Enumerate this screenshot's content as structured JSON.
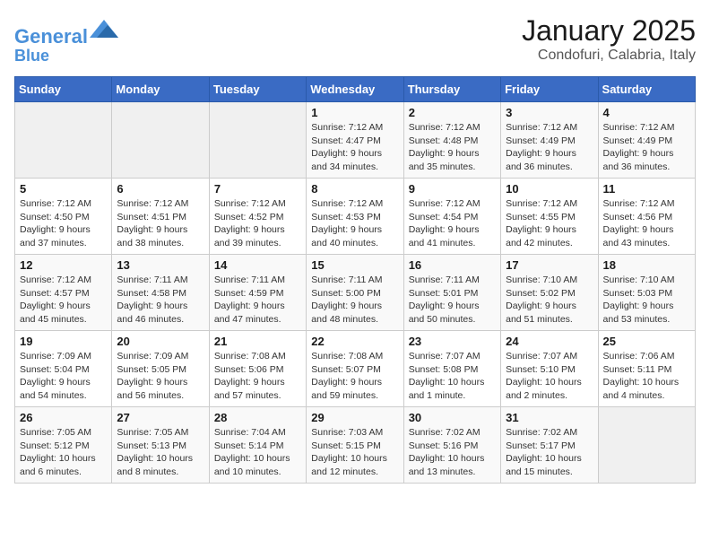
{
  "header": {
    "logo_line1": "General",
    "logo_line2": "Blue",
    "month": "January 2025",
    "location": "Condofuri, Calabria, Italy"
  },
  "weekdays": [
    "Sunday",
    "Monday",
    "Tuesday",
    "Wednesday",
    "Thursday",
    "Friday",
    "Saturday"
  ],
  "weeks": [
    [
      {
        "day": "",
        "detail": ""
      },
      {
        "day": "",
        "detail": ""
      },
      {
        "day": "",
        "detail": ""
      },
      {
        "day": "1",
        "detail": "Sunrise: 7:12 AM\nSunset: 4:47 PM\nDaylight: 9 hours\nand 34 minutes."
      },
      {
        "day": "2",
        "detail": "Sunrise: 7:12 AM\nSunset: 4:48 PM\nDaylight: 9 hours\nand 35 minutes."
      },
      {
        "day": "3",
        "detail": "Sunrise: 7:12 AM\nSunset: 4:49 PM\nDaylight: 9 hours\nand 36 minutes."
      },
      {
        "day": "4",
        "detail": "Sunrise: 7:12 AM\nSunset: 4:49 PM\nDaylight: 9 hours\nand 36 minutes."
      }
    ],
    [
      {
        "day": "5",
        "detail": "Sunrise: 7:12 AM\nSunset: 4:50 PM\nDaylight: 9 hours\nand 37 minutes."
      },
      {
        "day": "6",
        "detail": "Sunrise: 7:12 AM\nSunset: 4:51 PM\nDaylight: 9 hours\nand 38 minutes."
      },
      {
        "day": "7",
        "detail": "Sunrise: 7:12 AM\nSunset: 4:52 PM\nDaylight: 9 hours\nand 39 minutes."
      },
      {
        "day": "8",
        "detail": "Sunrise: 7:12 AM\nSunset: 4:53 PM\nDaylight: 9 hours\nand 40 minutes."
      },
      {
        "day": "9",
        "detail": "Sunrise: 7:12 AM\nSunset: 4:54 PM\nDaylight: 9 hours\nand 41 minutes."
      },
      {
        "day": "10",
        "detail": "Sunrise: 7:12 AM\nSunset: 4:55 PM\nDaylight: 9 hours\nand 42 minutes."
      },
      {
        "day": "11",
        "detail": "Sunrise: 7:12 AM\nSunset: 4:56 PM\nDaylight: 9 hours\nand 43 minutes."
      }
    ],
    [
      {
        "day": "12",
        "detail": "Sunrise: 7:12 AM\nSunset: 4:57 PM\nDaylight: 9 hours\nand 45 minutes."
      },
      {
        "day": "13",
        "detail": "Sunrise: 7:11 AM\nSunset: 4:58 PM\nDaylight: 9 hours\nand 46 minutes."
      },
      {
        "day": "14",
        "detail": "Sunrise: 7:11 AM\nSunset: 4:59 PM\nDaylight: 9 hours\nand 47 minutes."
      },
      {
        "day": "15",
        "detail": "Sunrise: 7:11 AM\nSunset: 5:00 PM\nDaylight: 9 hours\nand 48 minutes."
      },
      {
        "day": "16",
        "detail": "Sunrise: 7:11 AM\nSunset: 5:01 PM\nDaylight: 9 hours\nand 50 minutes."
      },
      {
        "day": "17",
        "detail": "Sunrise: 7:10 AM\nSunset: 5:02 PM\nDaylight: 9 hours\nand 51 minutes."
      },
      {
        "day": "18",
        "detail": "Sunrise: 7:10 AM\nSunset: 5:03 PM\nDaylight: 9 hours\nand 53 minutes."
      }
    ],
    [
      {
        "day": "19",
        "detail": "Sunrise: 7:09 AM\nSunset: 5:04 PM\nDaylight: 9 hours\nand 54 minutes."
      },
      {
        "day": "20",
        "detail": "Sunrise: 7:09 AM\nSunset: 5:05 PM\nDaylight: 9 hours\nand 56 minutes."
      },
      {
        "day": "21",
        "detail": "Sunrise: 7:08 AM\nSunset: 5:06 PM\nDaylight: 9 hours\nand 57 minutes."
      },
      {
        "day": "22",
        "detail": "Sunrise: 7:08 AM\nSunset: 5:07 PM\nDaylight: 9 hours\nand 59 minutes."
      },
      {
        "day": "23",
        "detail": "Sunrise: 7:07 AM\nSunset: 5:08 PM\nDaylight: 10 hours\nand 1 minute."
      },
      {
        "day": "24",
        "detail": "Sunrise: 7:07 AM\nSunset: 5:10 PM\nDaylight: 10 hours\nand 2 minutes."
      },
      {
        "day": "25",
        "detail": "Sunrise: 7:06 AM\nSunset: 5:11 PM\nDaylight: 10 hours\nand 4 minutes."
      }
    ],
    [
      {
        "day": "26",
        "detail": "Sunrise: 7:05 AM\nSunset: 5:12 PM\nDaylight: 10 hours\nand 6 minutes."
      },
      {
        "day": "27",
        "detail": "Sunrise: 7:05 AM\nSunset: 5:13 PM\nDaylight: 10 hours\nand 8 minutes."
      },
      {
        "day": "28",
        "detail": "Sunrise: 7:04 AM\nSunset: 5:14 PM\nDaylight: 10 hours\nand 10 minutes."
      },
      {
        "day": "29",
        "detail": "Sunrise: 7:03 AM\nSunset: 5:15 PM\nDaylight: 10 hours\nand 12 minutes."
      },
      {
        "day": "30",
        "detail": "Sunrise: 7:02 AM\nSunset: 5:16 PM\nDaylight: 10 hours\nand 13 minutes."
      },
      {
        "day": "31",
        "detail": "Sunrise: 7:02 AM\nSunset: 5:17 PM\nDaylight: 10 hours\nand 15 minutes."
      },
      {
        "day": "",
        "detail": ""
      }
    ]
  ]
}
